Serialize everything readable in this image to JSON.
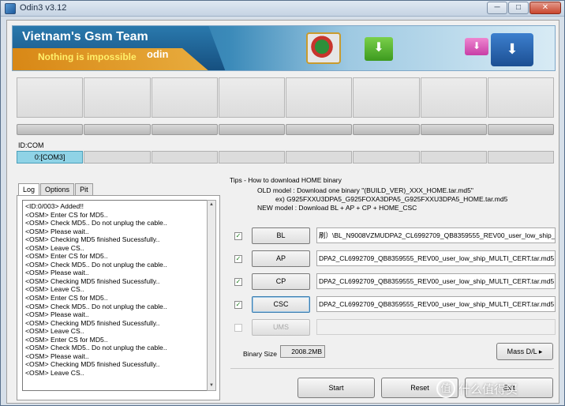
{
  "window": {
    "title": "Odin3 v3.12",
    "controls": {
      "minimize": "─",
      "maximize": "□",
      "close": "✕"
    }
  },
  "banner": {
    "brand": "Vietnam's Gsm Team",
    "slogan": "Nothing is impossible",
    "product": "odin"
  },
  "device": {
    "idcom_label": "ID:COM",
    "ports": [
      "0:[COM3]",
      "",
      "",
      "",
      "",
      "",
      "",
      ""
    ]
  },
  "tabs": [
    "Log",
    "Options",
    "Pit"
  ],
  "log": [
    "<ID:0/003> Added!!",
    "<OSM> Enter CS for MD5..",
    "<OSM> Check MD5.. Do not unplug the cable..",
    "<OSM> Please wait..",
    "<OSM> Checking MD5 finished Sucessfully..",
    "<OSM> Leave CS..",
    "<OSM> Enter CS for MD5..",
    "<OSM> Check MD5.. Do not unplug the cable..",
    "<OSM> Please wait..",
    "<OSM> Checking MD5 finished Sucessfully..",
    "<OSM> Leave CS..",
    "<OSM> Enter CS for MD5..",
    "<OSM> Check MD5.. Do not unplug the cable..",
    "<OSM> Please wait..",
    "<OSM> Checking MD5 finished Sucessfully..",
    "<OSM> Leave CS..",
    "<OSM> Enter CS for MD5..",
    "<OSM> Check MD5.. Do not unplug the cable..",
    "<OSM> Please wait..",
    "<OSM> Checking MD5 finished Sucessfully..",
    "<OSM> Leave CS.."
  ],
  "tips": {
    "title": "Tips - How to download HOME binary",
    "old_model": "OLD model  : Download one binary    \"(BUILD_VER)_XXX_HOME.tar.md5\"",
    "example": "ex) G925FXXU3DPA5_G925FOXA3DPA5_G925FXXU3DPA5_HOME.tar.md5",
    "new_model": "NEW model : Download BL + AP + CP + HOME_CSC"
  },
  "files": [
    {
      "label": "BL",
      "checked": true,
      "path": "刷）\\BL_N9008VZMUDPA2_CL6992709_QB8359555_REV00_user_low_ship_"
    },
    {
      "label": "AP",
      "checked": true,
      "path": "DPA2_CL6992709_QB8359555_REV00_user_low_ship_MULTI_CERT.tar.md5"
    },
    {
      "label": "CP",
      "checked": true,
      "path": "DPA2_CL6992709_QB8359555_REV00_user_low_ship_MULTI_CERT.tar.md5"
    },
    {
      "label": "CSC",
      "checked": true,
      "path": "DPA2_CL6992709_QB8359555_REV00_user_low_ship_MULTI_CERT.tar.md5"
    },
    {
      "label": "UMS",
      "checked": false,
      "path": ""
    }
  ],
  "binary_size": {
    "label": "Binary Size",
    "value": "2008.2MB"
  },
  "buttons": {
    "mass_dl": "Mass D/L ▸",
    "start": "Start",
    "reset": "Reset",
    "exit": "Exit"
  },
  "watermark": {
    "text": "什么值得买",
    "icon": "值"
  }
}
